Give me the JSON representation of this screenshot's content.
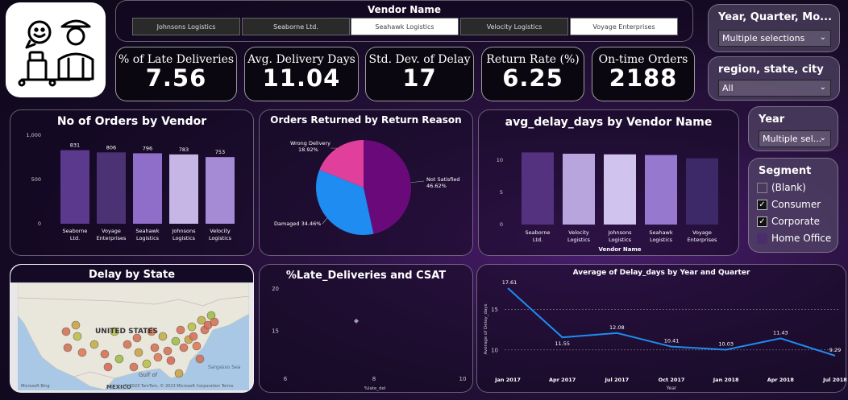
{
  "vendor_slicer": {
    "title": "Vendor Name",
    "options": [
      {
        "label": "Johnsons Logistics",
        "selected": true
      },
      {
        "label": "Seaborne Ltd.",
        "selected": true
      },
      {
        "label": "Seahawk Logistics",
        "selected": false
      },
      {
        "label": "Velocity Logistics",
        "selected": true
      },
      {
        "label": "Voyage Enterprises",
        "selected": false
      }
    ]
  },
  "kpis": [
    {
      "title": "% of Late Deliveries",
      "value": "7.56"
    },
    {
      "title": "Avg. Delivery Days",
      "value": "11.04"
    },
    {
      "title": "Std. Dev. of Delay",
      "value": "17"
    },
    {
      "title": "Return Rate (%)",
      "value": "6.25"
    },
    {
      "title": "On-time Orders",
      "value": "2188"
    }
  ],
  "filters": {
    "date": {
      "title": "Year, Quarter, Mo...",
      "value": "Multiple selections"
    },
    "region": {
      "title": "region, state, city",
      "value": "All"
    },
    "year": {
      "title": "Year",
      "value": "Multiple sel..."
    },
    "segment": {
      "title": "Segment",
      "items": [
        {
          "label": "(Blank)",
          "checked": false
        },
        {
          "label": "Consumer",
          "checked": true
        },
        {
          "label": "Corporate",
          "checked": true
        },
        {
          "label": "Home Office",
          "checked": false
        }
      ]
    }
  },
  "map": {
    "title": "Delay by State",
    "country_label": "UNITED STATES",
    "gulf_label": "Gulf of",
    "mexico_label": "MEXICO",
    "sea_label": "Sargasso Sea",
    "bing_label": "Microsoft Bing",
    "attribution": "© 2023 TomTom, © 2023 Microsoft Corporation  Terms"
  },
  "chart_data": [
    {
      "type": "bar",
      "title": "No of Orders by Vendor",
      "categories": [
        "Seaborne Ltd.",
        "Voyage Enterprises",
        "Seahawk Logistics",
        "Johnsons Logistics",
        "Velocity Logistics"
      ],
      "values": [
        831,
        806,
        796,
        783,
        753
      ],
      "yticks": [
        "0",
        "500",
        "1,000"
      ],
      "ylim": [
        0,
        1000
      ],
      "colors": [
        "#5b3a8e",
        "#4b3275",
        "#8f6ec9",
        "#c6b6e6",
        "#a58bd6"
      ]
    },
    {
      "type": "pie",
      "title": "Orders Returned by Return Reason",
      "slices": [
        {
          "name": "Not Satisfied",
          "pct": 46.62,
          "label": "46.62%",
          "color": "#6a0a7a"
        },
        {
          "name": "Damaged",
          "pct": 34.46,
          "label": "34.46%",
          "color": "#1e8cf0"
        },
        {
          "name": "Wrong Delivery",
          "pct": 18.92,
          "label": "18.92%",
          "color": "#e0409c"
        }
      ]
    },
    {
      "type": "bar",
      "title": "avg_delay_days by Vendor Name",
      "xlabel": "Vendor Name",
      "categories": [
        "Seaborne Ltd.",
        "Velocity Logistics",
        "Johnsons Logistics",
        "Seahawk Logistics",
        "Voyage Enterprises"
      ],
      "values": [
        11.2,
        11.0,
        10.9,
        10.8,
        10.3
      ],
      "yticks": [
        "0",
        "5",
        "10"
      ],
      "ylim": [
        0,
        13
      ],
      "colors": [
        "#55327f",
        "#b9a5de",
        "#d0c3ee",
        "#9678cf",
        "#3d2868"
      ]
    },
    {
      "type": "scatter",
      "title": "%Late_Deliveries and CSAT",
      "xlabel": "%late_del",
      "x_ticks": [
        "6",
        "8",
        "10"
      ],
      "y_ticks": [
        "15",
        "20"
      ],
      "xlim": [
        6,
        10
      ],
      "ylim": [
        10,
        20
      ],
      "points": [
        {
          "x": 7.6,
          "y": 16.2
        }
      ]
    },
    {
      "type": "line",
      "title": "Average of Delay_days by Year and Quarter",
      "xlabel": "Year",
      "ylabel": "Average of Delay_days",
      "categories": [
        "Jan 2017",
        "Apr 2017",
        "Jul 2017",
        "Oct 2017",
        "Jan 2018",
        "Apr 2018",
        "Jul 2018"
      ],
      "values": [
        17.61,
        11.55,
        12.08,
        10.41,
        10.03,
        11.43,
        9.29
      ],
      "labels": [
        "17.61",
        "11.55",
        "12.08",
        "10.41",
        "10.03",
        "11.43",
        "9.29"
      ],
      "yticks": [
        "10",
        "15"
      ],
      "ylim": [
        8,
        18.5
      ]
    }
  ]
}
